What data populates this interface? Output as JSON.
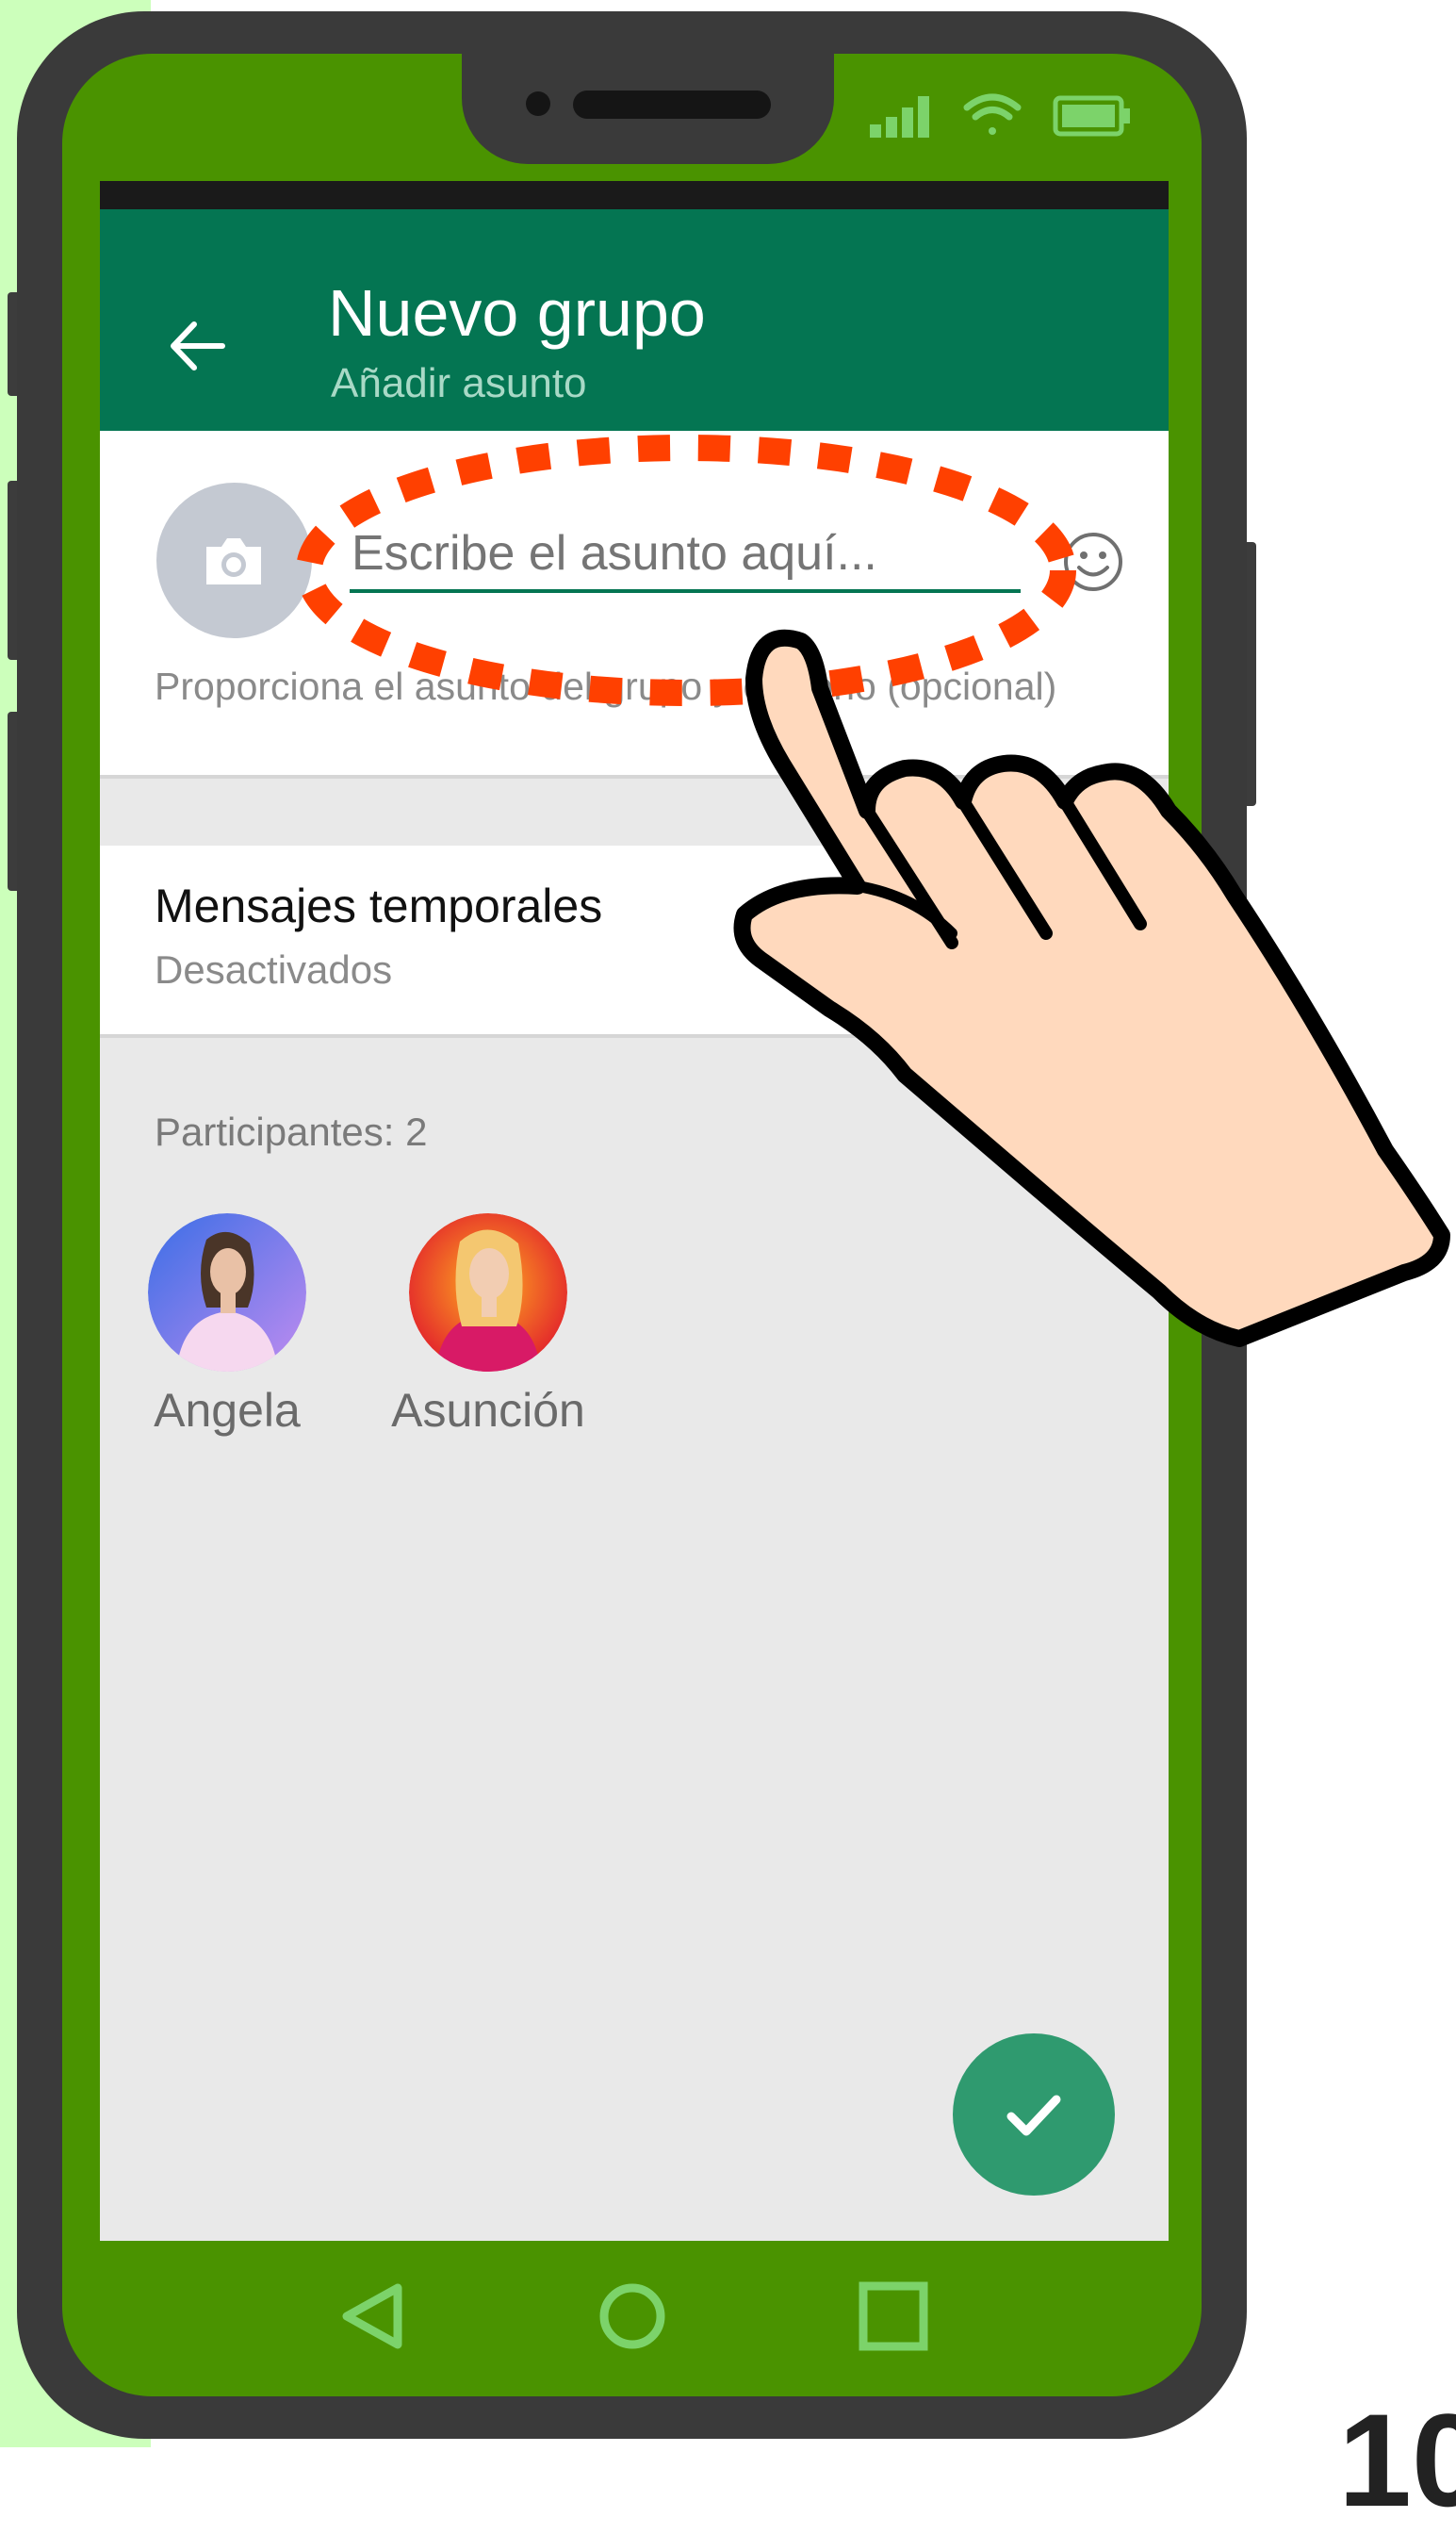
{
  "app_bar": {
    "title": "Nuevo grupo",
    "subtitle": "Añadir asunto"
  },
  "subject": {
    "placeholder": "Escribe el asunto aquí...",
    "hint": "Proporciona el asunto del grupo y el icono (opcional)"
  },
  "temporary_messages": {
    "title": "Mensajes temporales",
    "status": "Desactivados"
  },
  "participants": {
    "label": "Participantes: 2",
    "members": [
      {
        "name": "Angela"
      },
      {
        "name": "Asunción"
      }
    ]
  },
  "icons": {
    "back": "arrow-left-icon",
    "camera": "camera-icon",
    "emoji": "smiley-icon",
    "confirm": "check-icon",
    "nav": [
      "triangle-back-icon",
      "circle-home-icon",
      "square-recents-icon"
    ],
    "status": [
      "signal-icon",
      "wifi-icon",
      "battery-icon"
    ]
  },
  "colors": {
    "app_bar": "#047552",
    "accent": "#2f9a6f",
    "phone_frame": "#4a9300",
    "highlight": "#ff4000",
    "hand_fill": "#ffd9bd"
  }
}
